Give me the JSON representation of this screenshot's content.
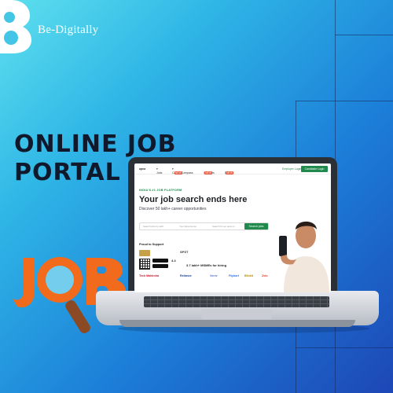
{
  "brand": {
    "name": "Be-Digitally"
  },
  "headline": {
    "line1": "ONLINE JOB",
    "line2": "PORTAL"
  },
  "art": {
    "word": "JOB"
  },
  "colors": {
    "accent_green": "#1f8a4c",
    "job_orange": "#f26a1b",
    "headline": "#10182b"
  },
  "screen": {
    "nav": {
      "logo": "apna",
      "jobs": "Jobs",
      "career_compass": "Career Compass",
      "contests": "Contests",
      "degree": "Degree",
      "new_tag": "NEW",
      "employer_login": "Employer Login",
      "candidate_login": "Candidate Login"
    },
    "kicker": "INDIA'S #1 JOB PLATFORM",
    "title": "Your job search ends here",
    "subtitle": "Discover 50 lakh+ career opportunities",
    "search": {
      "skills_placeholder": "Search jobs by skill",
      "experience_placeholder": "Your Experience",
      "location_placeholder": "Search for an area or...",
      "button": "Search jobs"
    },
    "proud": "Proud to Support",
    "spst": "SPST",
    "rating": "4.4",
    "msme": "3.7 lakh+ MSMEs for hiring",
    "brands": [
      "Tech Mahindra",
      "Reliance",
      "Verve",
      "Flipkart",
      "Blinkit",
      "Zolo"
    ]
  }
}
